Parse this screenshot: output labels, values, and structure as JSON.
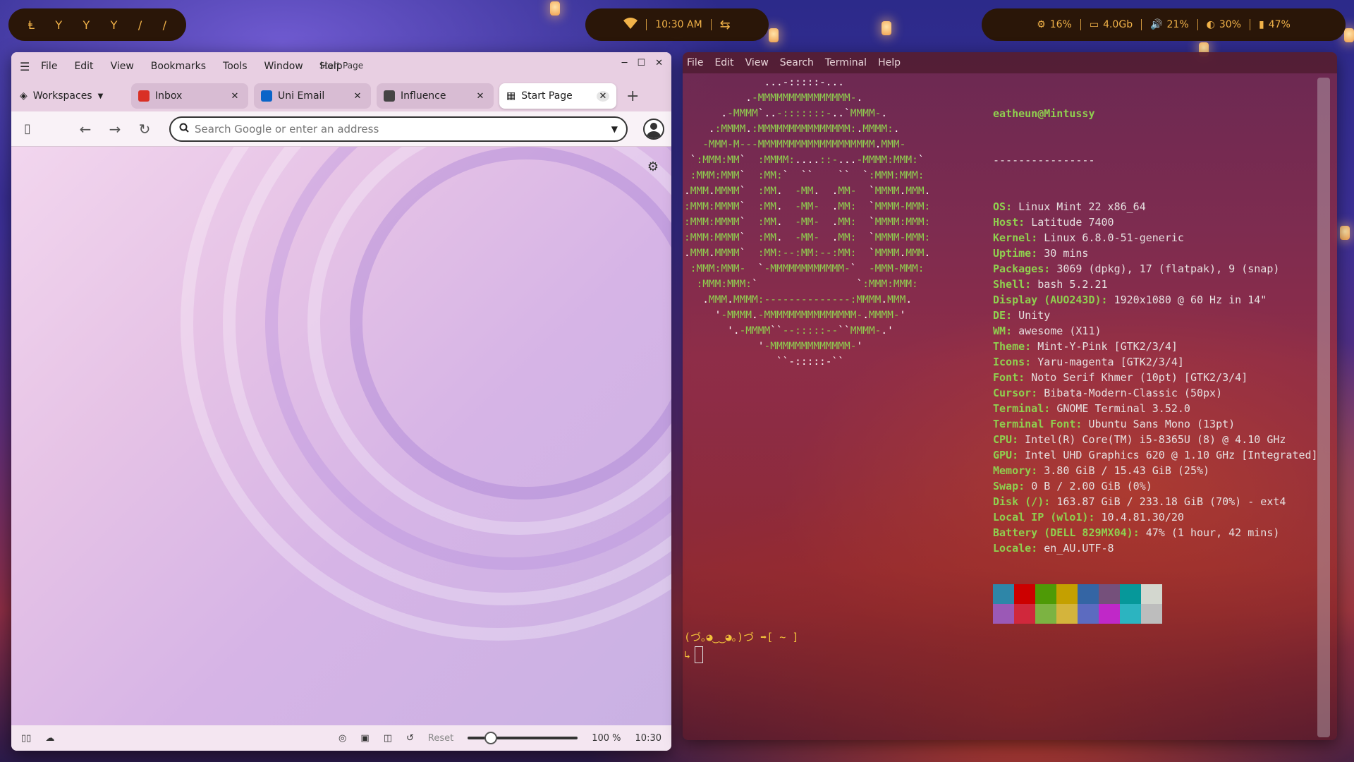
{
  "topbar": {
    "workspaces": [
      "Ⱡ",
      "Y",
      "Y",
      "Y",
      "/",
      "/"
    ],
    "clock": "10:30 AM",
    "stats": [
      {
        "icon": "cpu-icon",
        "glyph": "⚙",
        "value": "16%"
      },
      {
        "icon": "memory-icon",
        "glyph": "▭",
        "value": "4.0Gb"
      },
      {
        "icon": "volume-icon",
        "glyph": "🔊",
        "value": "21%"
      },
      {
        "icon": "brightness-icon",
        "glyph": "◐",
        "value": "30%"
      },
      {
        "icon": "battery-icon",
        "glyph": "▮",
        "value": "47%"
      }
    ]
  },
  "browser": {
    "window_title": "Start Page",
    "menu": [
      "File",
      "Edit",
      "View",
      "Bookmarks",
      "Tools",
      "Window",
      "Help"
    ],
    "workspaces_label": "Workspaces",
    "tabs": [
      {
        "label": "Inbox",
        "favicon_color": "#d93025",
        "active": false
      },
      {
        "label": "Uni Email",
        "favicon_color": "#0a64c8",
        "active": false
      },
      {
        "label": "Influence",
        "favicon_color": "#444444",
        "active": false
      },
      {
        "label": "Start Page",
        "favicon_color": "#333333",
        "active": true
      }
    ],
    "address_placeholder": "Search Google or enter an address",
    "status": {
      "reset_label": "Reset",
      "zoom_value": "100 %",
      "time": "10:30",
      "zoom_slider_fraction": 0.17
    }
  },
  "terminal": {
    "menu": [
      "File",
      "Edit",
      "View",
      "Search",
      "Terminal",
      "Help"
    ],
    "user_host": "eatheun@Mintussy",
    "separator": "----------------",
    "info": [
      {
        "key": "OS",
        "value": "Linux Mint 22 x86_64"
      },
      {
        "key": "Host",
        "value": "Latitude 7400"
      },
      {
        "key": "Kernel",
        "value": "Linux 6.8.0-51-generic"
      },
      {
        "key": "Uptime",
        "value": "30 mins"
      },
      {
        "key": "Packages",
        "value": "3069 (dpkg), 17 (flatpak), 9 (snap)"
      },
      {
        "key": "Shell",
        "value": "bash 5.2.21"
      },
      {
        "key": "Display (AUO243D)",
        "value": "1920x1080 @ 60 Hz in 14\""
      },
      {
        "key": "DE",
        "value": "Unity"
      },
      {
        "key": "WM",
        "value": "awesome (X11)"
      },
      {
        "key": "Theme",
        "value": "Mint-Y-Pink [GTK2/3/4]"
      },
      {
        "key": "Icons",
        "value": "Yaru-magenta [GTK2/3/4]"
      },
      {
        "key": "Font",
        "value": "Noto Serif Khmer (10pt) [GTK2/3/4]"
      },
      {
        "key": "Cursor",
        "value": "Bibata-Modern-Classic (50px)"
      },
      {
        "key": "Terminal",
        "value": "GNOME Terminal 3.52.0"
      },
      {
        "key": "Terminal Font",
        "value": "Ubuntu Sans Mono (13pt)"
      },
      {
        "key": "CPU",
        "value": "Intel(R) Core(TM) i5-8365U (8) @ 4.10 GHz"
      },
      {
        "key": "GPU",
        "value": "Intel UHD Graphics 620 @ 1.10 GHz [Integrated]"
      },
      {
        "key": "Memory",
        "value": "3.80 GiB / 15.43 GiB (25%)"
      },
      {
        "key": "Swap",
        "value": "0 B / 2.00 GiB (0%)"
      },
      {
        "key": "Disk (/)",
        "value": "163.87 GiB / 233.18 GiB (70%) - ext4"
      },
      {
        "key": "Local IP (wlo1)",
        "value": "10.4.81.30/20"
      },
      {
        "key": "Battery (DELL 829MX04)",
        "value": "47% (1 hour, 42 mins)"
      },
      {
        "key": "Locale",
        "value": "en_AU.UTF-8"
      }
    ],
    "logo_lines": [
      "             ...-:::::-...",
      "          .-MMMMMMMMMMMMMMM-.",
      "      .-MMMM`..-:::::::-..`MMMM-.",
      "    .:MMMM.:MMMMMMMMMMMMMMM:.MMMM:.",
      "   -MMM-M---MMMMMMMMMMMMMMMMMMM.MMM-",
      " `:MMM:MM`  :MMMM:....::-...-MMMM:MMM:`",
      " :MMM:MMM`  :MM:`  ``    ``  `:MMM:MMM:",
      ".MMM.MMMM`  :MM.  -MM.  .MM-  `MMMM.MMM.",
      ":MMM:MMMM`  :MM.  -MM-  .MM:  `MMMM-MMM:",
      ":MMM:MMMM`  :MM.  -MM-  .MM:  `MMMM:MMM:",
      ":MMM:MMMM`  :MM.  -MM-  .MM:  `MMMM-MMM:",
      ".MMM.MMMM`  :MM:--:MM:--:MM:  `MMMM.MMM.",
      " :MMM:MMM-  `-MMMMMMMMMMMM-`  -MMM-MMM:",
      "  :MMM:MMM:`                `:MMM:MMM:",
      "   .MMM.MMMM:--------------:MMMM.MMM.",
      "     '-MMMM.-MMMMMMMMMMMMMMM-.MMMM-'",
      "       '.-MMMM``--:::::--``MMMM-.'",
      "            '-MMMMMMMMMMMMM-'",
      "               ``-:::::-``"
    ],
    "palette_top": [
      "#2e86a8",
      "#cc0000",
      "#4e9a06",
      "#c4a000",
      "#3465a4",
      "#75507b",
      "#06989a",
      "#d3d7cf"
    ],
    "palette_bottom": [
      "#9b59b6",
      "#d0283c",
      "#7cb342",
      "#d4b43c",
      "#5c6bc0",
      "#c028c8",
      "#2cb4c0",
      "#bdbdbd"
    ],
    "prompt": "(づ｡◕‿‿◕｡)づ ➡[ ~ ]",
    "prompt_arrow": "↳"
  }
}
